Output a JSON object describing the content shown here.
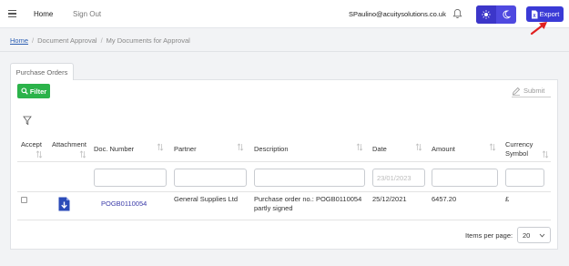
{
  "header": {
    "nav": {
      "home": "Home",
      "sign_out": "Sign Out"
    },
    "user_email": "SPaulino@acuitysolutions.co.uk",
    "export_label": "Export",
    "icons": {
      "menu": "menu-icon",
      "bell": "bell-icon",
      "sun": "sun-icon",
      "moon": "moon-icon",
      "export": "export-file-icon"
    }
  },
  "breadcrumb": {
    "items": [
      "Home",
      "Document Approval",
      "My Documents for Approval"
    ],
    "separator": "/"
  },
  "tabs": [
    {
      "label": "Purchase Orders"
    }
  ],
  "toolbar": {
    "filter_label": "Filter",
    "submit_label": "Submit"
  },
  "table": {
    "columns": [
      "Accept",
      "Attachment",
      "Doc. Number",
      "Partner",
      "Description",
      "Date",
      "Amount",
      "Currency Symbol"
    ],
    "date_placeholder": "23/01/2023",
    "rows": [
      {
        "doc_number": "POGB0110054",
        "partner": "General Supplies Ltd",
        "description": "Purchase order no.: POGB0110054 partly signed",
        "date": "25/12/2021",
        "amount": "6457.20",
        "currency": "£"
      }
    ]
  },
  "pagination": {
    "items_per_page_label": "Items per page:",
    "items_per_page": "20"
  },
  "colors": {
    "accent": "#3a3ad6",
    "theme_toggle": "#4f49e0",
    "filter_green": "#2bb34a",
    "link": "#3a3aa8",
    "arrow_red": "#e02020"
  }
}
